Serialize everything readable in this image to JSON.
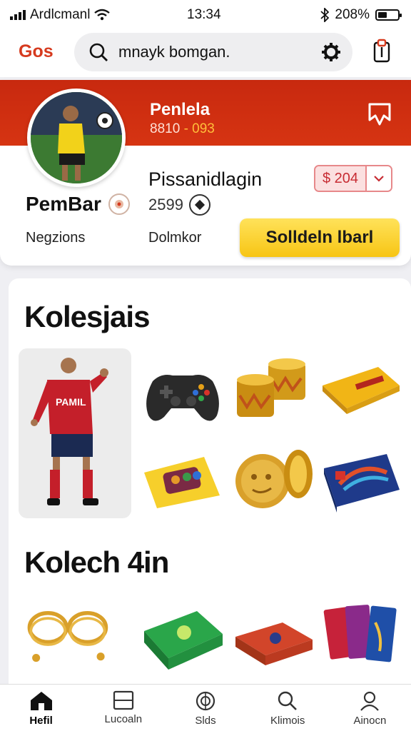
{
  "status_bar": {
    "carrier": "Ardlcmanl",
    "time": "13:34",
    "battery": "208%"
  },
  "header": {
    "brand": "Gos",
    "search_value": "mnayk bomgan.",
    "search_placeholder": "mnayk bomgan."
  },
  "profile": {
    "banner_title": "Penlela",
    "banner_sub_a": "8810",
    "banner_sub_b": "- 093",
    "user_name": "PemBar",
    "title": "Pissanidlagin",
    "score": "2599",
    "price": "$ 204",
    "label_left": "Negzions",
    "label_right": "Dolmkor",
    "action_label": "Solldeln lbarl"
  },
  "collections": {
    "section1_title": "Kolesjais",
    "section2_title": "Kolech 4in",
    "player_shirt": "PAMIL"
  },
  "nav": {
    "tabs": [
      {
        "label": "Hefil",
        "icon": "home-icon"
      },
      {
        "label": "Lucoaln",
        "icon": "square-icon"
      },
      {
        "label": "Slds",
        "icon": "radar-icon"
      },
      {
        "label": "Klimois",
        "icon": "search-icon"
      },
      {
        "label": "Ainocn",
        "icon": "user-icon"
      }
    ]
  },
  "colors": {
    "brand_red": "#d63a1e",
    "banner_red": "#c8290f",
    "action_yellow": "#f7c514"
  }
}
